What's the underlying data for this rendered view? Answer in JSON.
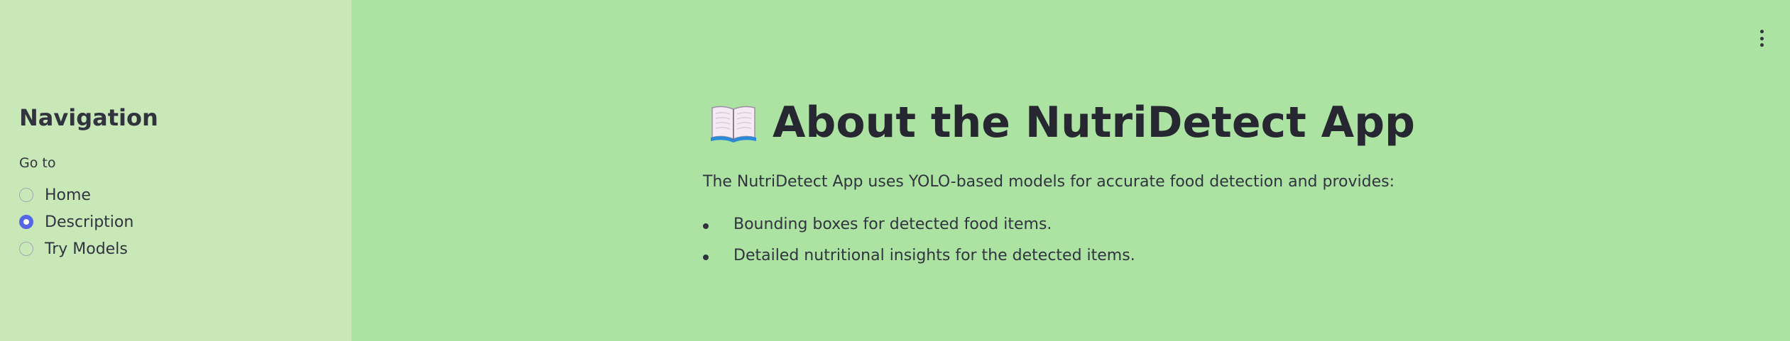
{
  "sidebar": {
    "title": "Navigation",
    "radio_label": "Go to",
    "options": [
      {
        "label": "Home",
        "selected": false
      },
      {
        "label": "Description",
        "selected": true
      },
      {
        "label": "Try Models",
        "selected": false
      }
    ]
  },
  "main": {
    "title": "About the NutriDetect App",
    "title_icon": "book-icon",
    "intro": "The NutriDetect App uses YOLO-based models for accurate food detection and provides:",
    "bullets": [
      "Bounding boxes for detected food items.",
      "Detailed nutritional insights for the detected items."
    ]
  },
  "header": {
    "menu_icon": "vertical-ellipsis-icon"
  },
  "colors": {
    "sidebar_bg": "#c9e8b8",
    "main_bg": "#ace3a3",
    "accent": "#5566e8",
    "text": "#31333f"
  }
}
